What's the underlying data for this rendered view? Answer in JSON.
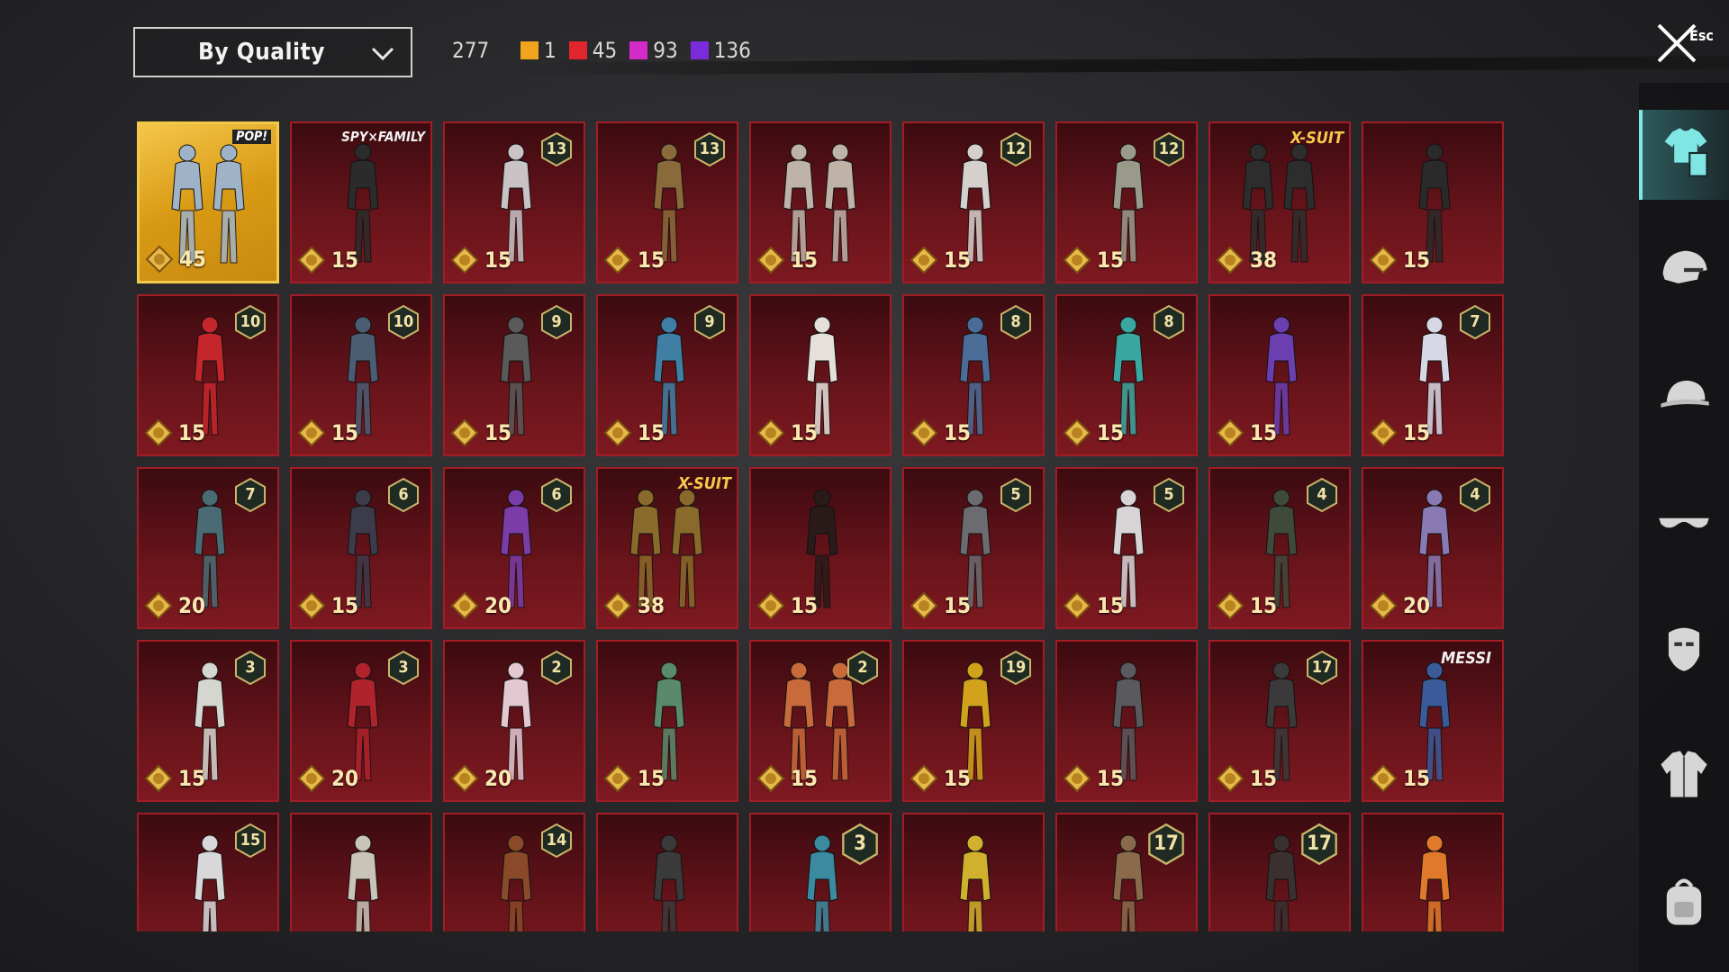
{
  "header": {
    "sort_label": "By Quality",
    "total": "277",
    "counts": [
      {
        "value": "1",
        "color": "#f2a51c"
      },
      {
        "value": "45",
        "color": "#e0262c"
      },
      {
        "value": "93",
        "color": "#d42bc8"
      },
      {
        "value": "136",
        "color": "#7a2bdc"
      }
    ],
    "esc_label": "Esc"
  },
  "items": [
    {
      "price": "45",
      "level": "",
      "tag": "POP!",
      "gold": true,
      "pair": true,
      "color": "#9fb3c8"
    },
    {
      "price": "15",
      "level": "",
      "tag": "SPY×FAMILY",
      "color": "#2b2b2b"
    },
    {
      "price": "15",
      "level": "13",
      "tag": "",
      "color": "#c9c3c6"
    },
    {
      "price": "15",
      "level": "13",
      "tag": "",
      "color": "#8a6a3a"
    },
    {
      "price": "15",
      "level": "",
      "tag": "",
      "pair": true,
      "color": "#bfb3a8"
    },
    {
      "price": "15",
      "level": "12",
      "tag": "",
      "color": "#d6d0cc"
    },
    {
      "price": "15",
      "level": "12",
      "tag": "",
      "color": "#9a9a8a"
    },
    {
      "price": "38",
      "level": "",
      "tag": "X-SUIT",
      "pair": true,
      "color": "#2d2d2d"
    },
    {
      "price": "15",
      "level": "",
      "tag": "",
      "color": "#2a2a2a"
    },
    {
      "price": "15",
      "level": "10",
      "tag": "",
      "color": "#c4262c"
    },
    {
      "price": "15",
      "level": "10",
      "tag": "",
      "color": "#4a5d72"
    },
    {
      "price": "15",
      "level": "9",
      "tag": "",
      "color": "#5a5a5a"
    },
    {
      "price": "15",
      "level": "9",
      "tag": "",
      "color": "#3f7fa3"
    },
    {
      "price": "15",
      "level": "",
      "tag": "",
      "color": "#e5e1da"
    },
    {
      "price": "15",
      "level": "8",
      "tag": "",
      "color": "#4b6c97"
    },
    {
      "price": "15",
      "level": "8",
      "tag": "",
      "color": "#3aa7a0"
    },
    {
      "price": "15",
      "level": "",
      "tag": "",
      "color": "#6b3fb0"
    },
    {
      "price": "15",
      "level": "7",
      "tag": "",
      "color": "#d7d7e6"
    },
    {
      "price": "20",
      "level": "7",
      "tag": "",
      "color": "#4a6b73"
    },
    {
      "price": "15",
      "level": "6",
      "tag": "",
      "color": "#3b3b4a"
    },
    {
      "price": "20",
      "level": "6",
      "tag": "",
      "color": "#7b3ca8"
    },
    {
      "price": "38",
      "level": "",
      "tag": "X-SUIT",
      "pair": true,
      "color": "#8a6a2a"
    },
    {
      "price": "15",
      "level": "",
      "tag": "",
      "color": "#2a1a1a"
    },
    {
      "price": "15",
      "level": "5",
      "tag": "",
      "color": "#6c6c70"
    },
    {
      "price": "15",
      "level": "5",
      "tag": "",
      "color": "#d8d4d6"
    },
    {
      "price": "15",
      "level": "4",
      "tag": "",
      "color": "#3f4a3a"
    },
    {
      "price": "20",
      "level": "4",
      "tag": "",
      "color": "#8a7ab4"
    },
    {
      "price": "15",
      "level": "3",
      "tag": "",
      "color": "#d6d6d0"
    },
    {
      "price": "20",
      "level": "3",
      "tag": "",
      "color": "#b0222c"
    },
    {
      "price": "20",
      "level": "2",
      "tag": "",
      "color": "#e3c8d2"
    },
    {
      "price": "15",
      "level": "",
      "tag": "",
      "color": "#5a8a6a"
    },
    {
      "price": "15",
      "level": "2",
      "tag": "",
      "pair": true,
      "color": "#c96a3a"
    },
    {
      "price": "15",
      "level": "19",
      "tag": "",
      "color": "#d3a21c"
    },
    {
      "price": "15",
      "level": "",
      "tag": "",
      "color": "#5a5a5e"
    },
    {
      "price": "15",
      "level": "17",
      "tag": "",
      "color": "#3a3a3a"
    },
    {
      "price": "15",
      "level": "",
      "tag": "MESSI",
      "color": "#3a5a9a"
    },
    {
      "price": "",
      "level": "15",
      "tag": "",
      "color": "#d8d8d8"
    },
    {
      "price": "",
      "level": "",
      "tag": "",
      "color": "#c9c3b8"
    },
    {
      "price": "",
      "level": "14",
      "tag": "",
      "color": "#8a4a2a"
    },
    {
      "price": "",
      "level": "",
      "tag": "",
      "color": "#3a3a3a"
    },
    {
      "price": "",
      "level": "3",
      "tag": "",
      "big": true,
      "color": "#3a8aa0"
    },
    {
      "price": "",
      "level": "",
      "tag": "",
      "color": "#d0b02c"
    },
    {
      "price": "",
      "level": "17",
      "tag": "",
      "big": true,
      "color": "#8a6a4a"
    },
    {
      "price": "",
      "level": "17",
      "tag": "",
      "big": true,
      "color": "#3a3030"
    },
    {
      "price": "",
      "level": "",
      "tag": "",
      "color": "#e07a2a"
    }
  ],
  "categories": [
    {
      "name": "outfit-icon",
      "active": true
    },
    {
      "name": "helmet-icon",
      "active": false
    },
    {
      "name": "cap-icon",
      "active": false
    },
    {
      "name": "glasses-icon",
      "active": false
    },
    {
      "name": "mask-icon",
      "active": false
    },
    {
      "name": "jacket-icon",
      "active": false
    },
    {
      "name": "backpack-icon",
      "active": false
    }
  ]
}
